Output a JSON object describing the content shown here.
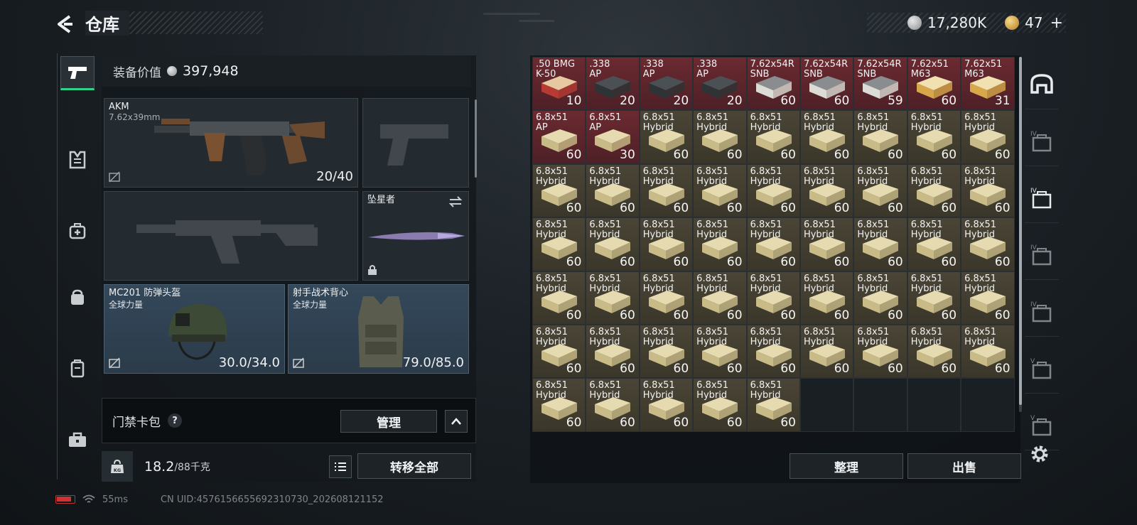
{
  "header": {
    "title": "仓库"
  },
  "currency": {
    "silver": "17,280K",
    "gold": "47"
  },
  "loadout": {
    "value_label": "装备价值",
    "value": "397,948",
    "primary": {
      "name": "AKM",
      "caliber": "7.62x39mm",
      "ammo": "20/40"
    },
    "melee": {
      "name": "坠星者"
    },
    "helmet": {
      "name": "MC201 防弹头盔",
      "maker": "全球力量",
      "durability": "30.0/34.0"
    },
    "vest": {
      "name": "射手战术背心",
      "maker": "全球力量",
      "durability": "79.0/85.0"
    },
    "keycard_label": "门禁卡包",
    "help": "?",
    "manage_button": "管理",
    "weight_value": "18.2",
    "weight_max": "/88千克",
    "weight_unit_icon": "KG",
    "transfer_all_button": "转移全部"
  },
  "stash": {
    "items": [
      {
        "l1": ".50 BMG",
        "l2": "K-50",
        "count": "10",
        "color": "red",
        "icon": "ammo-box-red"
      },
      {
        "l1": ".338",
        "l2": "AP",
        "count": "20",
        "color": "red",
        "icon": "ammo-case-dark"
      },
      {
        "l1": ".338",
        "l2": "AP",
        "count": "20",
        "color": "red",
        "icon": "ammo-case-dark"
      },
      {
        "l1": ".338",
        "l2": "AP",
        "count": "20",
        "color": "red",
        "icon": "ammo-case-dark"
      },
      {
        "l1": "7.62x54R",
        "l2": "SNB",
        "count": "60",
        "color": "red",
        "icon": "ammo-box-white"
      },
      {
        "l1": "7.62x54R",
        "l2": "SNB",
        "count": "60",
        "color": "red",
        "icon": "ammo-box-white"
      },
      {
        "l1": "7.62x54R",
        "l2": "SNB",
        "count": "59",
        "color": "red",
        "icon": "ammo-box-white"
      },
      {
        "l1": "7.62x51",
        "l2": "M63",
        "count": "60",
        "color": "red",
        "icon": "ammo-box-gold"
      },
      {
        "l1": "7.62x51",
        "l2": "M63",
        "count": "31",
        "color": "red",
        "icon": "ammo-box-gold"
      },
      {
        "l1": "6.8x51",
        "l2": "AP",
        "count": "60",
        "color": "red",
        "icon": "ammo-box-tan"
      },
      {
        "l1": "6.8x51",
        "l2": "AP",
        "count": "30",
        "color": "red",
        "icon": "ammo-box-tan"
      },
      {
        "l1": "6.8x51",
        "l2": "Hybrid",
        "count": "60",
        "color": "brown",
        "icon": "ammo-box-tan"
      },
      {
        "l1": "6.8x51",
        "l2": "Hybrid",
        "count": "60",
        "color": "brown",
        "icon": "ammo-box-tan"
      },
      {
        "l1": "6.8x51",
        "l2": "Hybrid",
        "count": "60",
        "color": "brown",
        "icon": "ammo-box-tan"
      },
      {
        "l1": "6.8x51",
        "l2": "Hybrid",
        "count": "60",
        "color": "brown",
        "icon": "ammo-box-tan"
      },
      {
        "l1": "6.8x51",
        "l2": "Hybrid",
        "count": "60",
        "color": "brown",
        "icon": "ammo-box-tan"
      },
      {
        "l1": "6.8x51",
        "l2": "Hybrid",
        "count": "60",
        "color": "brown",
        "icon": "ammo-box-tan"
      },
      {
        "l1": "6.8x51",
        "l2": "Hybrid",
        "count": "60",
        "color": "brown",
        "icon": "ammo-box-tan"
      },
      {
        "l1": "6.8x51",
        "l2": "Hybrid",
        "count": "60",
        "color": "brown",
        "icon": "ammo-box-tan"
      },
      {
        "l1": "6.8x51",
        "l2": "Hybrid",
        "count": "60",
        "color": "brown",
        "icon": "ammo-box-tan"
      },
      {
        "l1": "6.8x51",
        "l2": "Hybrid",
        "count": "60",
        "color": "brown",
        "icon": "ammo-box-tan"
      },
      {
        "l1": "6.8x51",
        "l2": "Hybrid",
        "count": "60",
        "color": "brown",
        "icon": "ammo-box-tan"
      },
      {
        "l1": "6.8x51",
        "l2": "Hybrid",
        "count": "60",
        "color": "brown",
        "icon": "ammo-box-tan"
      },
      {
        "l1": "6.8x51",
        "l2": "Hybrid",
        "count": "60",
        "color": "brown",
        "icon": "ammo-box-tan"
      },
      {
        "l1": "6.8x51",
        "l2": "Hybrid",
        "count": "60",
        "color": "brown",
        "icon": "ammo-box-tan"
      },
      {
        "l1": "6.8x51",
        "l2": "Hybrid",
        "count": "60",
        "color": "brown",
        "icon": "ammo-box-tan"
      },
      {
        "l1": "6.8x51",
        "l2": "Hybrid",
        "count": "60",
        "color": "brown",
        "icon": "ammo-box-tan"
      },
      {
        "l1": "6.8x51",
        "l2": "Hybrid",
        "count": "60",
        "color": "brown",
        "icon": "ammo-box-tan"
      },
      {
        "l1": "6.8x51",
        "l2": "Hybrid",
        "count": "60",
        "color": "brown",
        "icon": "ammo-box-tan"
      },
      {
        "l1": "6.8x51",
        "l2": "Hybrid",
        "count": "60",
        "color": "brown",
        "icon": "ammo-box-tan"
      },
      {
        "l1": "6.8x51",
        "l2": "Hybrid",
        "count": "60",
        "color": "brown",
        "icon": "ammo-box-tan"
      },
      {
        "l1": "6.8x51",
        "l2": "Hybrid",
        "count": "60",
        "color": "brown",
        "icon": "ammo-box-tan"
      },
      {
        "l1": "6.8x51",
        "l2": "Hybrid",
        "count": "60",
        "color": "brown",
        "icon": "ammo-box-tan"
      },
      {
        "l1": "6.8x51",
        "l2": "Hybrid",
        "count": "60",
        "color": "brown",
        "icon": "ammo-box-tan"
      },
      {
        "l1": "6.8x51",
        "l2": "Hybrid",
        "count": "60",
        "color": "brown",
        "icon": "ammo-box-tan"
      },
      {
        "l1": "6.8x51",
        "l2": "Hybrid",
        "count": "60",
        "color": "brown",
        "icon": "ammo-box-tan"
      },
      {
        "l1": "6.8x51",
        "l2": "Hybrid",
        "count": "60",
        "color": "brown",
        "icon": "ammo-box-tan"
      },
      {
        "l1": "6.8x51",
        "l2": "Hybrid",
        "count": "60",
        "color": "brown",
        "icon": "ammo-box-tan"
      },
      {
        "l1": "6.8x51",
        "l2": "Hybrid",
        "count": "60",
        "color": "brown",
        "icon": "ammo-box-tan"
      },
      {
        "l1": "6.8x51",
        "l2": "Hybrid",
        "count": "60",
        "color": "brown",
        "icon": "ammo-box-tan"
      },
      {
        "l1": "6.8x51",
        "l2": "Hybrid",
        "count": "60",
        "color": "brown",
        "icon": "ammo-box-tan"
      },
      {
        "l1": "6.8x51",
        "l2": "Hybrid",
        "count": "60",
        "color": "brown",
        "icon": "ammo-box-tan"
      },
      {
        "l1": "6.8x51",
        "l2": "Hybrid",
        "count": "60",
        "color": "brown",
        "icon": "ammo-box-tan"
      },
      {
        "l1": "6.8x51",
        "l2": "Hybrid",
        "count": "60",
        "color": "brown",
        "icon": "ammo-box-tan"
      },
      {
        "l1": "6.8x51",
        "l2": "Hybrid",
        "count": "60",
        "color": "brown",
        "icon": "ammo-box-tan"
      },
      {
        "l1": "6.8x51",
        "l2": "Hybrid",
        "count": "60",
        "color": "brown",
        "icon": "ammo-box-tan"
      },
      {
        "l1": "6.8x51",
        "l2": "Hybrid",
        "count": "60",
        "color": "brown",
        "icon": "ammo-box-tan"
      },
      {
        "l1": "6.8x51",
        "l2": "Hybrid",
        "count": "60",
        "color": "brown",
        "icon": "ammo-box-tan"
      },
      {
        "l1": "6.8x51",
        "l2": "Hybrid",
        "count": "60",
        "color": "brown",
        "icon": "ammo-box-tan"
      },
      {
        "l1": "6.8x51",
        "l2": "Hybrid",
        "count": "60",
        "color": "brown",
        "icon": "ammo-box-tan"
      },
      {
        "l1": "6.8x51",
        "l2": "Hybrid",
        "count": "60",
        "color": "brown",
        "icon": "ammo-box-tan"
      },
      {
        "l1": "6.8x51",
        "l2": "Hybrid",
        "count": "60",
        "color": "brown",
        "icon": "ammo-box-tan"
      },
      {
        "l1": "6.8x51",
        "l2": "Hybrid",
        "count": "60",
        "color": "brown",
        "icon": "ammo-box-tan"
      },
      {
        "l1": "6.8x51",
        "l2": "Hybrid",
        "count": "60",
        "color": "brown",
        "icon": "ammo-box-tan"
      },
      {
        "l1": "6.8x51",
        "l2": "Hybrid",
        "count": "60",
        "color": "brown",
        "icon": "ammo-box-tan"
      },
      {
        "l1": "6.8x51",
        "l2": "Hybrid",
        "count": "60",
        "color": "brown",
        "icon": "ammo-box-tan"
      },
      {
        "l1": "6.8x51",
        "l2": "Hybrid",
        "count": "60",
        "color": "brown",
        "icon": "ammo-box-tan"
      },
      {
        "l1": "6.8x51",
        "l2": "Hybrid",
        "count": "60",
        "color": "brown",
        "icon": "ammo-box-tan"
      },
      {
        "l1": "6.8x51",
        "l2": "Hybrid",
        "count": "60",
        "color": "brown",
        "icon": "ammo-box-tan"
      }
    ],
    "sort_button": "整理",
    "sell_button": "出售"
  },
  "right_tabs": [
    {
      "name": "stash-tab-main",
      "icon": "stash-icon",
      "level": ""
    },
    {
      "name": "stash-tab-medical",
      "icon": "medkit-icon",
      "level": "IV"
    },
    {
      "name": "stash-tab-ammo",
      "icon": "ammo-crate-icon",
      "level": "IV"
    },
    {
      "name": "stash-tab-gear",
      "icon": "gear-crate-icon",
      "level": "IV"
    },
    {
      "name": "stash-tab-weapons",
      "icon": "weapon-crate-icon",
      "level": "IV"
    },
    {
      "name": "stash-tab-valuables",
      "icon": "valuables-icon",
      "level": "V"
    },
    {
      "name": "stash-tab-misc",
      "icon": "misc-crate-icon",
      "level": "V"
    }
  ],
  "footer": {
    "ping": "55ms",
    "uid": "CN UID:4576156655692310730_202608121152"
  },
  "colors": {
    "accent": "#2fd28a",
    "rare_red": "#6b2a30",
    "common_brown": "#4a4536",
    "slot_blue": "#34485a"
  }
}
